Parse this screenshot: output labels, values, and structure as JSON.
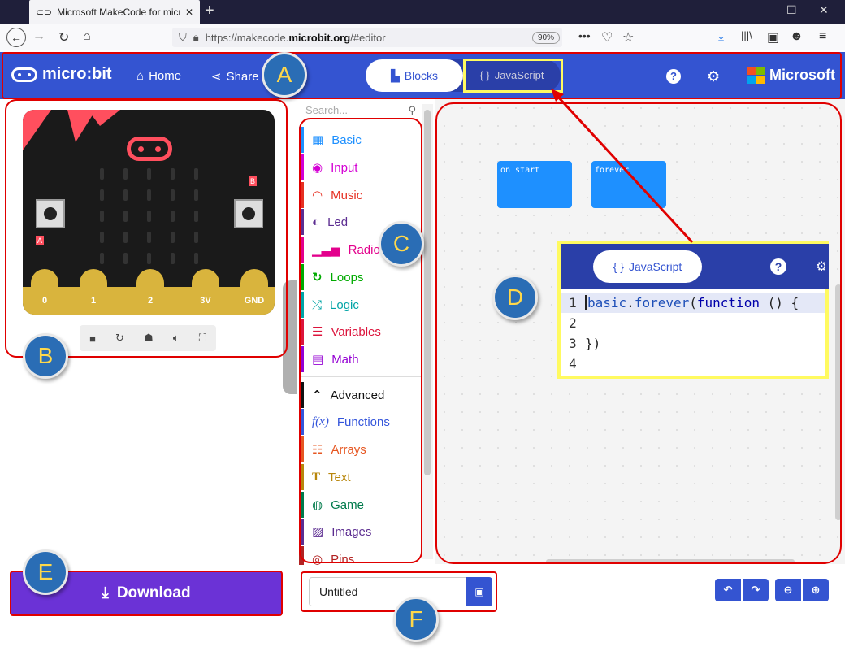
{
  "browser": {
    "tab_title": "Microsoft MakeCode for micro:bit",
    "url_prefix": "https://makecode.",
    "url_domain": "microbit.org",
    "url_path": "/#editor",
    "zoom": "90%"
  },
  "header": {
    "logo_text": "micro:bit",
    "home_label": "Home",
    "share_label": "Share",
    "blocks_label": "Blocks",
    "javascript_label": "JavaScript",
    "brand_label": "Microsoft"
  },
  "simulator": {
    "button_a": "A",
    "button_b": "B",
    "pins": [
      "0",
      "1",
      "2",
      "3V",
      "GND"
    ]
  },
  "toolbox": {
    "search_placeholder": "Search...",
    "categories": [
      {
        "label": "Basic",
        "icon": "grid-icon",
        "color": "#1e90ff"
      },
      {
        "label": "Input",
        "icon": "target-icon",
        "color": "#d400d4"
      },
      {
        "label": "Music",
        "icon": "headphones-icon",
        "color": "#e63022"
      },
      {
        "label": "Led",
        "icon": "toggle-icon",
        "color": "#5c2d91"
      },
      {
        "label": "Radio",
        "icon": "signal-icon",
        "color": "#e3008c"
      },
      {
        "label": "Loops",
        "icon": "loop-icon",
        "color": "#00aa00"
      },
      {
        "label": "Logic",
        "icon": "shuffle-icon",
        "color": "#00a4a6"
      },
      {
        "label": "Variables",
        "icon": "lines-icon",
        "color": "#dc143c"
      },
      {
        "label": "Math",
        "icon": "calculator-icon",
        "color": "#9400d3"
      },
      {
        "label": "Advanced",
        "icon": "chevron-up-icon",
        "color": "#111111"
      },
      {
        "label": "Functions",
        "icon": "function-icon",
        "color": "#3455db"
      },
      {
        "label": "Arrays",
        "icon": "list-icon",
        "color": "#e65722"
      },
      {
        "label": "Text",
        "icon": "text-icon",
        "color": "#b8860b"
      },
      {
        "label": "Game",
        "icon": "gamepad-icon",
        "color": "#007a4b"
      },
      {
        "label": "Images",
        "icon": "image-icon",
        "color": "#5c2d91"
      },
      {
        "label": "Pins",
        "icon": "pins-icon",
        "color": "#b22222"
      }
    ]
  },
  "workspace": {
    "block_on_start": "on start",
    "block_forever": "forever",
    "js_view_label": "JavaScript",
    "code_lines": [
      {
        "n": "1",
        "text": "basic.forever(function () {"
      },
      {
        "n": "2",
        "text": ""
      },
      {
        "n": "3",
        "text": "})"
      },
      {
        "n": "4",
        "text": ""
      }
    ]
  },
  "footer": {
    "download_label": "Download",
    "project_name": "Untitled"
  },
  "annotations": {
    "a": "A",
    "b": "B",
    "c": "C",
    "d": "D",
    "e": "E",
    "f": "F"
  },
  "colors": {
    "header_bg": "#3454d1",
    "download_bg": "#6b32d6",
    "annotation_red": "#e00000",
    "highlight_yellow": "#fffa60"
  }
}
